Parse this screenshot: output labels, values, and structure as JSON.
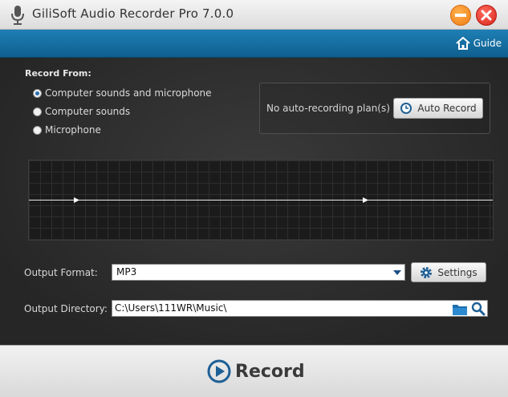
{
  "window": {
    "title": "GiliSoft Audio Recorder Pro 7.0.0",
    "guide_label": "Guide"
  },
  "record_from": {
    "heading": "Record From:",
    "options": [
      {
        "label": "Computer sounds and microphone",
        "selected": true
      },
      {
        "label": "Computer sounds",
        "selected": false
      },
      {
        "label": "Microphone",
        "selected": false
      }
    ]
  },
  "auto_record": {
    "status_text": "No auto-recording plan(s)",
    "button_label": "Auto Record"
  },
  "output": {
    "format_label": "Output Format:",
    "format_value": "MP3",
    "settings_label": "Settings",
    "directory_label": "Output Directory:",
    "directory_value": "C:\\Users\\111WR\\Music\\"
  },
  "record": {
    "button_label": "Record"
  },
  "colors": {
    "accent_blue": "#1479ad",
    "minimize": "#f07d16",
    "close": "#d8261b"
  }
}
